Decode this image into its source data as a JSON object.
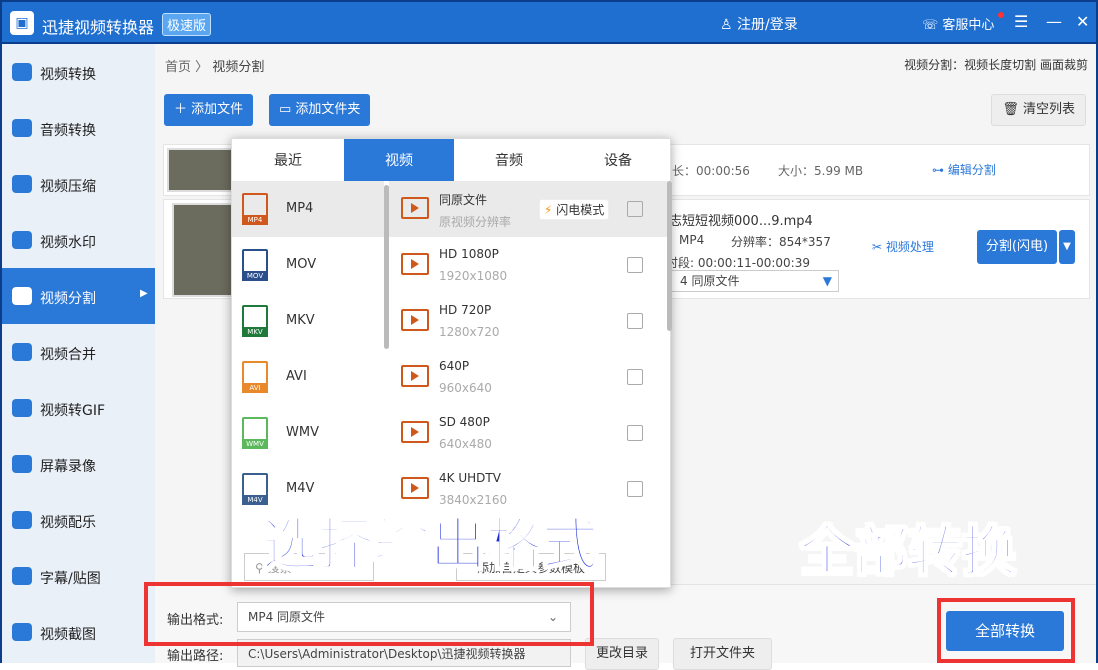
{
  "titlebar": {
    "app_title": "迅捷视频转换器",
    "edition": "极速版",
    "login": "注册/登录",
    "service": "客服中心",
    "menu_icon": "☰",
    "min_icon": "—",
    "close_icon": "✕"
  },
  "sidebar": {
    "items": [
      {
        "label": "视频转换"
      },
      {
        "label": "音频转换"
      },
      {
        "label": "视频压缩"
      },
      {
        "label": "视频水印"
      },
      {
        "label": "视频分割"
      },
      {
        "label": "视频合并"
      },
      {
        "label": "视频转GIF"
      },
      {
        "label": "屏幕录像"
      },
      {
        "label": "视频配乐"
      },
      {
        "label": "字幕/贴图"
      },
      {
        "label": "视频截图"
      }
    ]
  },
  "breadcrumb": {
    "home": "首页",
    "sep": "〉",
    "current": "视频分割"
  },
  "mode_info": "视频分割：视频长度切割 画面裁剪",
  "toolbar": {
    "add_file": "添加文件",
    "add_folder": "添加文件夹",
    "clear_list": "清空列表"
  },
  "file1": {
    "duration_label": "长：",
    "duration": "00:00:56",
    "size_label": "大小：",
    "size": "5.99 MB",
    "edit_split": "编辑分割"
  },
  "file2": {
    "name": "志短短视频000...9.mp4",
    "format": "MP4",
    "resolution_label": "分辨率：",
    "resolution": "854*357",
    "segment": "时段: 00:00:11-00:00:39",
    "output": "4  同原文件",
    "process": "视频处理",
    "split_btn": "分割(闪电)"
  },
  "dropdown": {
    "tabs": [
      "最近",
      "视频",
      "音频",
      "设备"
    ],
    "formats": [
      {
        "label": "MP4",
        "color": "#d0581c"
      },
      {
        "label": "MOV",
        "color": "#2b4f8c"
      },
      {
        "label": "MKV",
        "color": "#1f7a3a"
      },
      {
        "label": "AVI",
        "color": "#e8892b"
      },
      {
        "label": "WMV",
        "color": "#5cb85c"
      },
      {
        "label": "M4V",
        "color": "#3b5f8e"
      }
    ],
    "presets": [
      {
        "name": "同原文件",
        "desc": "原视频分辨率"
      },
      {
        "name": "HD 1080P",
        "desc": "1920x1080"
      },
      {
        "name": "HD 720P",
        "desc": "1280x720"
      },
      {
        "name": "640P",
        "desc": "960x640"
      },
      {
        "name": "SD 480P",
        "desc": "640x480"
      },
      {
        "name": "4K UHDTV",
        "desc": "3840x2160"
      }
    ],
    "flash_mode": "闪电模式",
    "search_placeholder": "搜索",
    "custom_btn": "添加自定义参数模板"
  },
  "bottom": {
    "output_format_label": "输出格式:",
    "output_format_value": "MP4  同原文件",
    "output_path_label": "输出路径:",
    "output_path_value": "C:\\Users\\Administrator\\Desktop\\迅捷视频转换器",
    "change_dir": "更改目录",
    "open_folder": "打开文件夹",
    "convert_all": "全部转换"
  },
  "overlay": {
    "left": "选择输出格式",
    "right": "全部转换"
  }
}
